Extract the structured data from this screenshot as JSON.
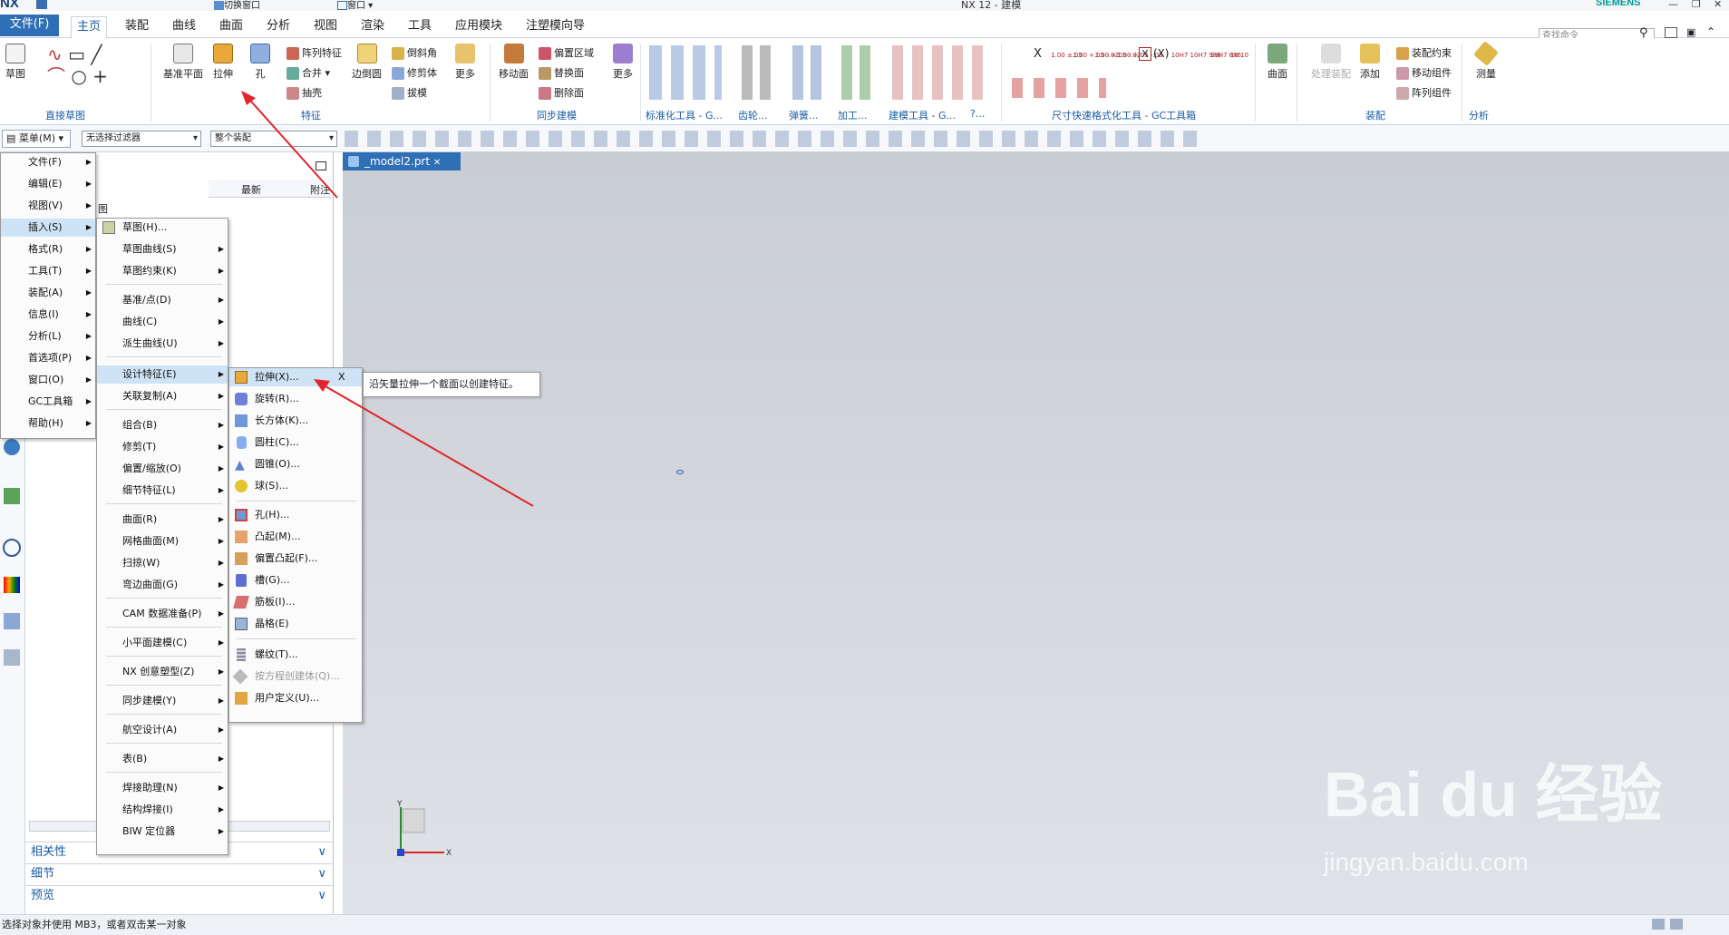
{
  "titlebar": {
    "logo": "NX",
    "title": "NX 12 - 建模",
    "brand": "SIEMENS",
    "qat": {
      "switch_window": "切换窗口",
      "window": "窗口"
    }
  },
  "tabs": [
    "文件(F)",
    "主页",
    "装配",
    "曲线",
    "曲面",
    "分析",
    "视图",
    "渲染",
    "工具",
    "应用模块",
    "注塑模向导"
  ],
  "search_placeholder": "查找命令",
  "ribbon": {
    "direct_sketch": {
      "sketch": "草图",
      "group": "直接草图"
    },
    "feature": {
      "datum_plane": "基准平面",
      "extrude": "拉伸",
      "hole": "孔",
      "pattern": "阵列特征",
      "unite": "合并",
      "shell": "抽壳",
      "edge_blend": "边倒圆",
      "chamfer": "倒斜角",
      "trim_body": "修剪体",
      "draft": "拔模",
      "more": "更多",
      "group": "特征"
    },
    "sync": {
      "move_face": "移动面",
      "offset_region": "偏置区域",
      "replace_face": "替换面",
      "delete_face": "删除面",
      "more": "更多",
      "group": "同步建模"
    },
    "std_tools": "标准化工具 - G...",
    "gear": "齿轮...",
    "spring": "弹簧...",
    "machining": "加工...",
    "modeling_tools": "建模工具 - G...",
    "q": "?...",
    "dim_group": "尺寸快速格式化工具 - GC工具箱",
    "dim_small": [
      "X",
      "1.00 ±.05",
      "1.00 +.05 -.02",
      "1.00 +.05 -.02",
      "1.00 +.05 -.03",
      "(X)",
      "10H7",
      "10H7 9h6",
      "10H7 8h6",
      "10 10"
    ],
    "surface": {
      "label": "曲面"
    },
    "assembly": {
      "handle": "处理装配",
      "add": "添加",
      "constraint": "装配约束",
      "move": "移动组件",
      "pattern": "阵列组件",
      "group": "装配"
    },
    "analysis": {
      "measure": "测量",
      "group": "分析"
    }
  },
  "toolbar2": {
    "menu_button": "菜单(M)",
    "filter": "无选择过滤器",
    "scope": "整个装配"
  },
  "main_menu": [
    "文件(F)",
    "编辑(E)",
    "视图(V)",
    "插入(S)",
    "格式(R)",
    "工具(T)",
    "装配(A)",
    "信息(I)",
    "分析(L)",
    "首选项(P)",
    "窗口(O)",
    "GC工具箱",
    "帮助(H)"
  ],
  "insert_menu": [
    "草图(H)...",
    "草图曲线(S)",
    "草图约束(K)",
    "基准/点(D)",
    "曲线(C)",
    "派生曲线(U)",
    "设计特征(E)",
    "关联复制(A)",
    "组合(B)",
    "修剪(T)",
    "偏置/缩放(O)",
    "细节特征(L)",
    "曲面(R)",
    "网格曲面(M)",
    "扫掠(W)",
    "弯边曲面(G)",
    "CAM 数据准备(P)",
    "小平面建模(C)",
    "NX 创意塑型(Z)",
    "同步建模(Y)",
    "航空设计(A)",
    "表(B)",
    "焊接助理(N)",
    "结构焊接(I)",
    "BIW 定位器"
  ],
  "design_menu": [
    "拉伸(X)...",
    "旋转(R)...",
    "长方体(K)...",
    "圆柱(C)...",
    "圆锥(O)...",
    "球(S)...",
    "孔(H)...",
    "凸起(M)...",
    "偏置凸起(F)...",
    "槽(G)...",
    "筋板(I)...",
    "晶格(E)",
    "螺纹(T)...",
    "按方程创建体(Q)...",
    "用户定义(U)..."
  ],
  "design_menu_close": "X",
  "tooltip": "沿矢量拉伸一个截面以创建特征。",
  "nav": {
    "col_latest": "最新",
    "col_note": "附注",
    "row": "图",
    "sections": [
      "相关性",
      "细节",
      "预览"
    ]
  },
  "doc_tab": "_model2.prt",
  "axes": {
    "x": "X",
    "y": "Y"
  },
  "status": "选择对象并使用 MB3，或者双击某一对象",
  "watermark": {
    "main": "Bai du 经验",
    "sub": "jingyan.baidu.com"
  },
  "colors": {
    "accent": "#2f6fb5",
    "arrow": "#e0262b",
    "highlight": "#cfe3f7"
  }
}
